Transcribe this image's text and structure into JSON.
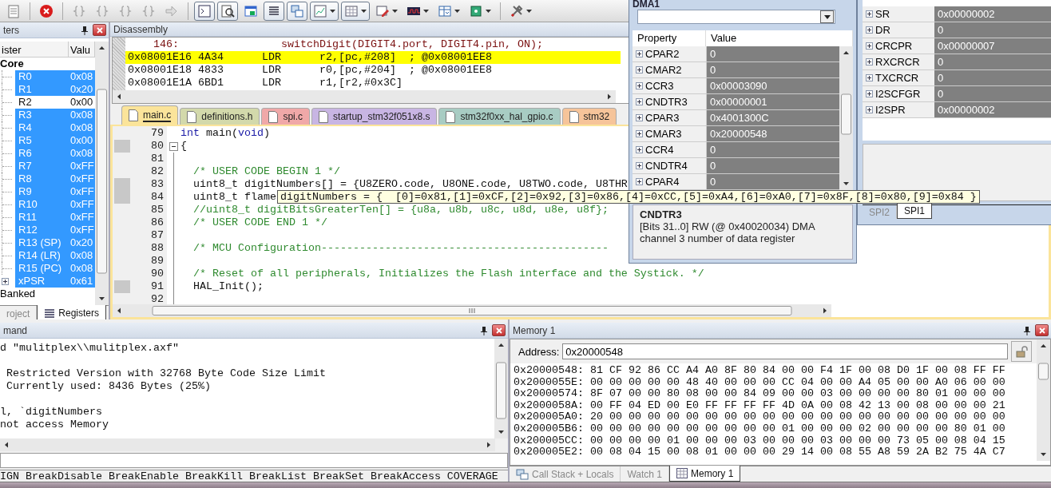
{
  "registers": {
    "title": "ters",
    "columns": [
      "ister",
      "Valu"
    ],
    "group_label": "Core",
    "rows": [
      {
        "name": "R0",
        "value": "0x08",
        "selected": true,
        "kind": "leaf"
      },
      {
        "name": "R1",
        "value": "0x20",
        "selected": true,
        "kind": "leaf"
      },
      {
        "name": "R2",
        "value": "0x00",
        "selected": false,
        "kind": "leaf"
      },
      {
        "name": "R3",
        "value": "0x08",
        "selected": true,
        "kind": "leaf"
      },
      {
        "name": "R4",
        "value": "0x08",
        "selected": true,
        "kind": "leaf"
      },
      {
        "name": "R5",
        "value": "0x00",
        "selected": true,
        "kind": "leaf"
      },
      {
        "name": "R6",
        "value": "0x08",
        "selected": true,
        "kind": "leaf"
      },
      {
        "name": "R7",
        "value": "0xFF",
        "selected": true,
        "kind": "leaf"
      },
      {
        "name": "R8",
        "value": "0xFF",
        "selected": true,
        "kind": "leaf"
      },
      {
        "name": "R9",
        "value": "0xFF",
        "selected": true,
        "kind": "leaf"
      },
      {
        "name": "R10",
        "value": "0xFF",
        "selected": true,
        "kind": "leaf"
      },
      {
        "name": "R11",
        "value": "0xFF",
        "selected": true,
        "kind": "leaf"
      },
      {
        "name": "R12",
        "value": "0xFF",
        "selected": true,
        "kind": "leaf"
      },
      {
        "name": "R13 (SP)",
        "value": "0x20",
        "selected": true,
        "kind": "leaf"
      },
      {
        "name": "R14 (LR)",
        "value": "0x08",
        "selected": true,
        "kind": "leaf"
      },
      {
        "name": "R15 (PC)",
        "value": "0x08",
        "selected": true,
        "kind": "leaf"
      },
      {
        "name": "xPSR",
        "value": "0x61",
        "selected": true,
        "kind": "collapsible"
      }
    ],
    "next_group_label": "Banked",
    "tabs": [
      {
        "label": "roject",
        "selected": false
      },
      {
        "label": "Registers",
        "selected": true
      }
    ]
  },
  "disassembly": {
    "title": "Disassembly",
    "lines": [
      {
        "text": "    146:                switchDigit(DIGIT4.port, DIGIT4.pin, ON);",
        "kind": "source",
        "current": false
      },
      {
        "text": "0x08001E16 4A34      LDR      r2,[pc,#208]  ; @0x08001EE8",
        "kind": "instruction",
        "current": true
      },
      {
        "text": "0x08001E18 4833      LDR      r0,[pc,#204]  ; @0x08001EE8",
        "kind": "instruction",
        "current": false
      },
      {
        "text": "0x08001E1A 6BD1      LDR      r1,[r2,#0x3C]",
        "kind": "instruction",
        "current": false
      }
    ]
  },
  "editor": {
    "tabs": [
      {
        "label": "main.c",
        "selected": true,
        "color": "#fbe49a"
      },
      {
        "label": "definitions.h",
        "selected": false,
        "color": "#d3d9ab"
      },
      {
        "label": "spi.c",
        "selected": false,
        "color": "#f0a8a8"
      },
      {
        "label": "startup_stm32f051x8.s",
        "selected": false,
        "color": "#c8b5e3"
      },
      {
        "label": "stm32f0xx_hal_gpio.c",
        "selected": false,
        "color": "#a8ccc3"
      },
      {
        "label": "stm32",
        "selected": false,
        "color": "#f6c49a"
      }
    ],
    "lines": [
      {
        "number": "79",
        "executable": false,
        "fold": false,
        "parts": [
          {
            "text": "int",
            "kind": "keyword"
          },
          {
            "text": " main(",
            "kind": "plain"
          },
          {
            "text": "void",
            "kind": "keyword"
          },
          {
            "text": ")",
            "kind": "plain"
          }
        ]
      },
      {
        "number": "80",
        "executable": true,
        "fold": true,
        "parts": [
          {
            "text": "{",
            "kind": "plain"
          }
        ]
      },
      {
        "number": "81",
        "executable": false,
        "fold": false
      },
      {
        "number": "82",
        "executable": false,
        "fold": false,
        "parts": [
          {
            "text": "  /* USER CODE BEGIN 1 */",
            "kind": "comment"
          }
        ]
      },
      {
        "number": "83",
        "executable": true,
        "fold": false,
        "parts": [
          {
            "text": "  uint8_t digitNumbers[] = {U8ZERO.code, U8ONE.code, U8TWO.code, U8THR",
            "kind": "plain"
          }
        ]
      },
      {
        "number": "84",
        "executable": true,
        "fold": false,
        "parts": [
          {
            "text": "  uint8_t flame",
            "kind": "plain"
          }
        ]
      },
      {
        "number": "85",
        "executable": false,
        "fold": false,
        "parts": [
          {
            "text": "  //uint8_t digitBitsGreaterTen[] = {u8a, u8b, u8c, u8d, u8e, u8f};",
            "kind": "comment"
          }
        ]
      },
      {
        "number": "86",
        "executable": false,
        "fold": false,
        "parts": [
          {
            "text": "  /* USER CODE END 1 */",
            "kind": "comment"
          }
        ]
      },
      {
        "number": "87",
        "executable": false,
        "fold": false
      },
      {
        "number": "88",
        "executable": false,
        "fold": false,
        "parts": [
          {
            "text": "  /* MCU Configuration---------------------------------------------",
            "kind": "comment"
          }
        ]
      },
      {
        "number": "89",
        "executable": false,
        "fold": false
      },
      {
        "number": "90",
        "executable": false,
        "fold": false,
        "parts": [
          {
            "text": "  /* Reset of all peripherals, Initializes the Flash interface and the Systick. */",
            "kind": "comment"
          }
        ]
      },
      {
        "number": "91",
        "executable": true,
        "fold": false,
        "parts": [
          {
            "text": "  HAL_Init();",
            "kind": "plain"
          }
        ]
      },
      {
        "number": "92",
        "executable": false,
        "fold": false
      }
    ],
    "hover_tooltip": "digitNumbers = {  [0]=0x81,[1]=0xCF,[2]=0x92,[3]=0x86,[4]=0xCC,[5]=0xA4,[6]=0xA0,[7]=0x8F,[8]=0x80,[9]=0x84 }"
  },
  "dma_window": {
    "title": "DMA1",
    "columns": [
      "Property",
      "Value"
    ],
    "rows": [
      {
        "property": "CPAR2",
        "value": "0"
      },
      {
        "property": "CMAR2",
        "value": "0"
      },
      {
        "property": "CCR3",
        "value": "0x00003090"
      },
      {
        "property": "CNDTR3",
        "value": "0x00000001"
      },
      {
        "property": "CPAR3",
        "value": "0x4001300C"
      },
      {
        "property": "CMAR3",
        "value": "0x20000548"
      },
      {
        "property": "CCR4",
        "value": "0"
      },
      {
        "property": "CNDTR4",
        "value": "0"
      },
      {
        "property": "CPAR4",
        "value": "0"
      }
    ],
    "description_title": "CNDTR3",
    "description": "[Bits 31..0] RW (@ 0x40020034) DMA channel 3 number of data  register"
  },
  "spi_window": {
    "rows": [
      {
        "property": "SR",
        "value": "0x00000002"
      },
      {
        "property": "DR",
        "value": "0"
      },
      {
        "property": "CRCPR",
        "value": "0x00000007"
      },
      {
        "property": "RXCRCR",
        "value": "0"
      },
      {
        "property": "TXCRCR",
        "value": "0"
      },
      {
        "property": "I2SCFGR",
        "value": "0"
      },
      {
        "property": "I2SPR",
        "value": "0x00000002"
      }
    ],
    "tabs": [
      {
        "label": "SPI2",
        "selected": false
      },
      {
        "label": "SPI1",
        "selected": true
      }
    ]
  },
  "command": {
    "title": "mand",
    "blocks": [
      [
        "d \"mulitplex\\\\mulitplex.axf\""
      ],
      [
        " Restricted Version with 32768 Byte Code Size Limit",
        " Currently used: 8436 Bytes (25%)"
      ],
      [
        "l, `digitNumbers",
        "not access Memory"
      ]
    ],
    "hint": "IGN BreakDisable BreakEnable BreakKill BreakList BreakSet BreakAccess COVERAGE"
  },
  "memory": {
    "title": "Memory 1",
    "address_label": "Address:",
    "address": "0x20000548",
    "rows": [
      "0x20000548: 81 CF 92 86 CC A4 A0 8F 80 84 00 00 F4 1F 00 08 D0 1F 00 08 FF FF",
      "0x2000055E: 00 00 00 00 00 48 40 00 00 00 CC 04 00 00 A4 05 00 00 A0 06 00 00",
      "0x20000574: 8F 07 00 00 80 08 00 00 84 09 00 00 03 00 00 00 00 80 01 00 00 00",
      "0x2000058A: 00 FF 04 ED 00 E0 FF FF FF FF 4D 0A 00 08 42 13 00 08 00 00 00 21",
      "0x200005A0: 20 00 00 00 00 00 00 00 00 00 00 00 00 00 00 00 00 00 00 00 00 00",
      "0x200005B6: 00 00 00 00 00 00 00 00 00 00 01 00 00 00 02 00 00 00 00 80 01 00",
      "0x200005CC: 00 00 00 00 01 00 00 00 03 00 00 00 03 00 00 00 73 05 00 08 04 15",
      "0x200005E2: 00 08 04 15 00 08 01 00 00 00 29 14 00 08 55 A8 59 2A B2 75 4A C7"
    ],
    "tabs": [
      {
        "label": "Call Stack + Locals",
        "selected": false,
        "kind": "stack"
      },
      {
        "label": "Watch 1",
        "selected": false,
        "kind": "plain"
      },
      {
        "label": "Memory 1",
        "selected": true,
        "kind": "grid"
      }
    ]
  }
}
